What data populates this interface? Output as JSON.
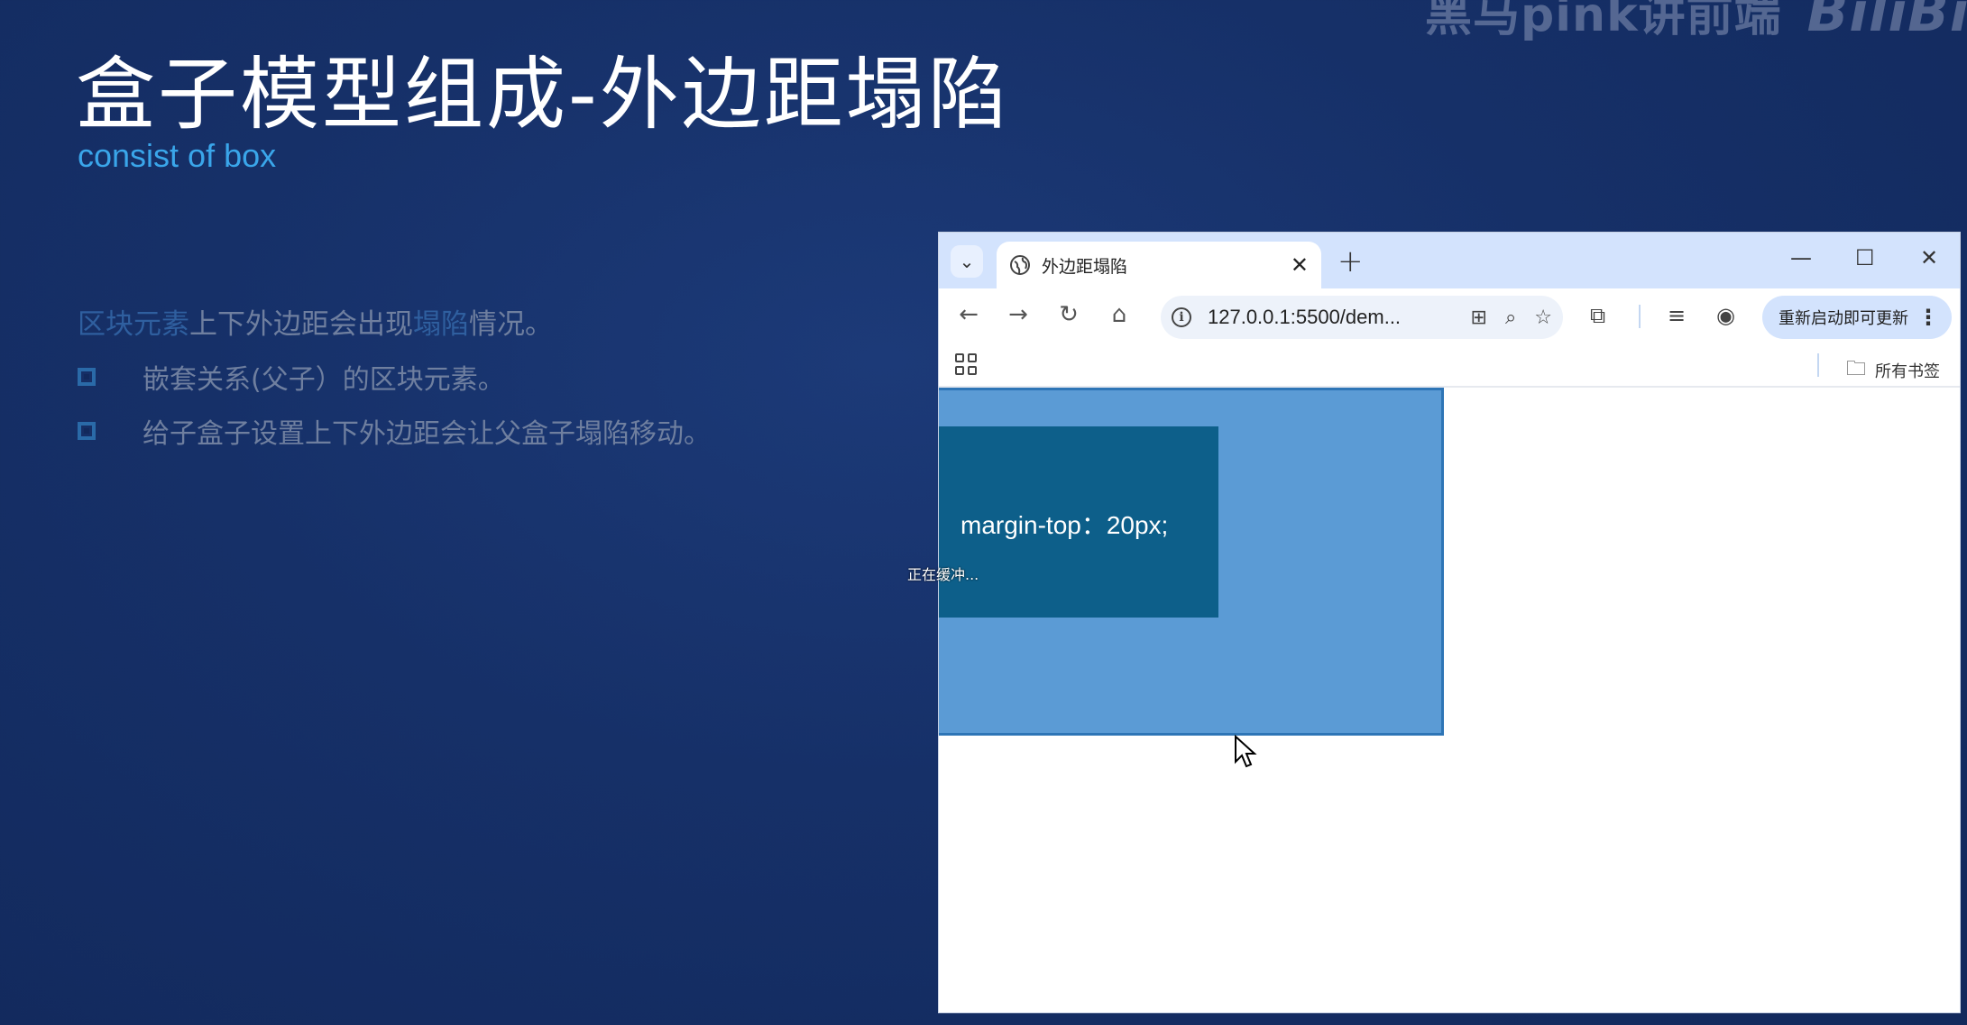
{
  "slide": {
    "watermark": "黑马pink讲前端",
    "watermark_logo": "BiliBili",
    "title": "盒子模型组成-外边距塌陷",
    "subtitle": "consist of box",
    "intro": {
      "hl1": "区块元素",
      "t1": "上下外边距会出现",
      "hl2": "塌陷",
      "t2": "情况。"
    },
    "bullets": [
      "嵌套关系(父子）的区块元素。",
      "给子盒子设置上下外边距会让父盒子塌陷移动。"
    ]
  },
  "browser": {
    "tab_title": "外边距塌陷",
    "tab_close": "✕",
    "new_tab": "+",
    "window_controls": {
      "minimize": "—",
      "maximize": "☐",
      "close": "✕"
    },
    "nav": {
      "back": "←",
      "forward": "→",
      "reload": "↻",
      "home": "⌂"
    },
    "url": "127.0.0.1:5500/dem...",
    "update_label": "重新启动即可更新",
    "update_menu": "⋮",
    "bookmarks_folder": "所有书签",
    "page": {
      "inner_text": "margin-top：20px;"
    },
    "buffering": "正在缓冲..."
  },
  "colors": {
    "background": "#163068",
    "accent": "#3aa6ea",
    "outer_box": "#5b9bd5",
    "inner_box": "#0d5f8a"
  }
}
